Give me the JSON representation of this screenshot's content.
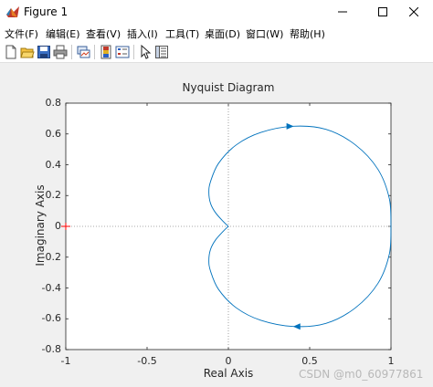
{
  "window": {
    "title": "Figure 1",
    "controls": [
      "minimize",
      "maximize",
      "close"
    ]
  },
  "menu": {
    "items": [
      "文件(F)",
      "编辑(E)",
      "查看(V)",
      "插入(I)",
      "工具(T)",
      "桌面(D)",
      "窗口(W)",
      "帮助(H)"
    ]
  },
  "toolbar": {
    "icons": [
      "new-figure-icon",
      "open-file-icon",
      "save-icon",
      "print-icon",
      "link-plot-icon",
      "insert-colorbar-icon",
      "insert-legend-icon",
      "edit-plot-icon",
      "property-inspector-icon"
    ]
  },
  "chart_data": {
    "type": "line",
    "title": "Nyquist Diagram",
    "xlabel": "Real Axis",
    "ylabel": "Imaginary Axis",
    "xlim": [
      -1,
      1
    ],
    "ylim": [
      -0.8,
      0.8
    ],
    "xticks": [
      "-1",
      "-0.5",
      "0",
      "0.5",
      "1"
    ],
    "yticks": [
      "0.8",
      "0.6",
      "0.4",
      "0.2",
      "0",
      "-0.2",
      "-0.4",
      "-0.6",
      "-0.8"
    ],
    "grid": false,
    "reference_lines": {
      "x": 0,
      "y": 0,
      "style": "dotted"
    },
    "critical_point": {
      "x": -1,
      "y": 0,
      "marker": "+",
      "color": "#ff0000"
    },
    "series_color": "#0072bd",
    "series": [
      {
        "x": [
          0,
          -0.03,
          -0.08,
          -0.11,
          -0.12,
          -0.11,
          -0.06,
          0.05,
          0.2,
          0.4,
          0.6,
          0.78,
          0.92,
          0.99,
          1.0
        ],
        "y": [
          0,
          -0.03,
          -0.09,
          -0.15,
          -0.22,
          -0.29,
          -0.41,
          -0.53,
          -0.61,
          -0.65,
          -0.63,
          -0.53,
          -0.37,
          -0.18,
          0
        ]
      },
      {
        "x": [
          1.0,
          0.99,
          0.92,
          0.78,
          0.6,
          0.4,
          0.2,
          0.05,
          -0.06,
          -0.11,
          -0.12,
          -0.11,
          -0.08,
          -0.03,
          0
        ],
        "y": [
          0,
          0.18,
          0.37,
          0.53,
          0.63,
          0.65,
          0.61,
          0.53,
          0.41,
          0.29,
          0.22,
          0.15,
          0.09,
          0.03,
          0
        ]
      }
    ],
    "arrows": [
      {
        "x": 0.38,
        "y": 0.65,
        "direction": "right"
      },
      {
        "x": 0.42,
        "y": -0.65,
        "direction": "left"
      }
    ]
  },
  "watermark": "CSDN @m0_60977861"
}
